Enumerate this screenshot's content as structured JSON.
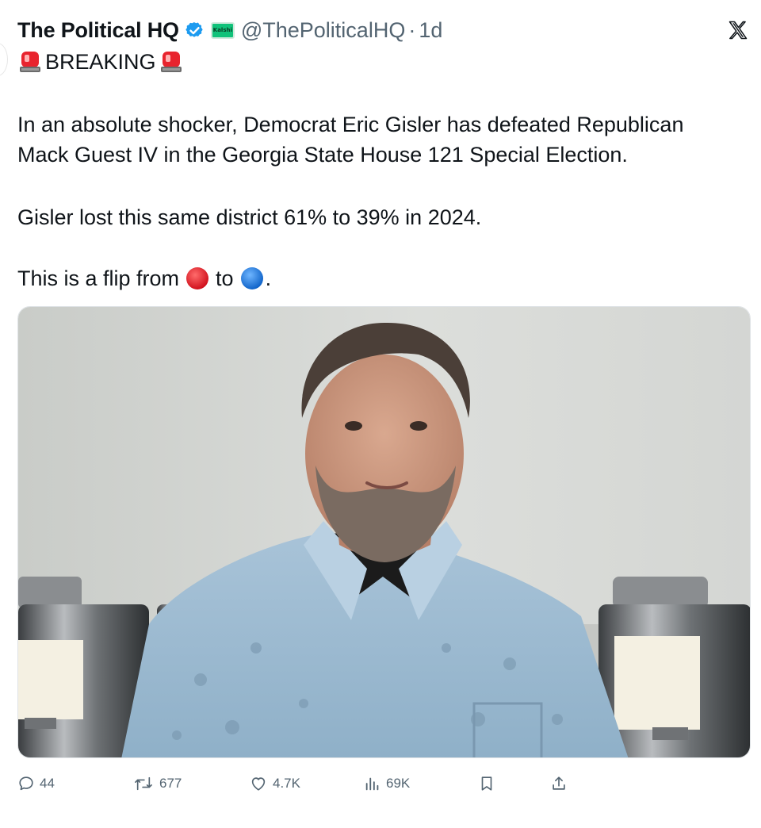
{
  "tweet": {
    "author_name": "The Political HQ",
    "affiliate_badge": "Kalshi",
    "handle": "@ThePoliticalHQ",
    "separator": "·",
    "time": "1d",
    "breaking": "BREAKING",
    "paragraph1": [
      "In an absolute shocker, Democrat Eric Gisler has defeated Republican",
      "Mack Guest IV in the Georgia State House 121 Special Election."
    ],
    "paragraph2": "Gisler lost this same district 61% to 39% in 2024.",
    "flip_prefix": "This is a flip from",
    "flip_middle": "to",
    "flip_suffix": "."
  },
  "icons": {
    "verified": "verified-badge-icon",
    "siren": "police-light-icon",
    "red_circle": "red-circle-icon",
    "blue_circle": "blue-circle-icon",
    "close": "x-logo-icon"
  },
  "actions": {
    "replies": "44",
    "reposts": "677",
    "likes": "4.7K",
    "views": "69K"
  },
  "colors": {
    "text": "#0f1419",
    "secondary": "#536471",
    "verified_blue": "#1d9bf0",
    "red": "#e8242e",
    "blue": "#1a78e5"
  }
}
